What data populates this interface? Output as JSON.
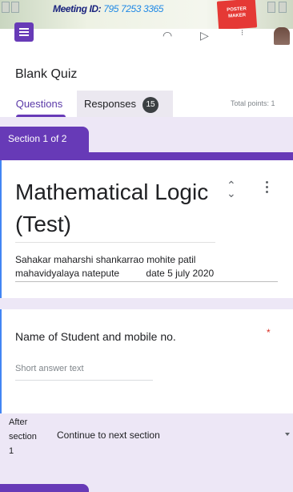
{
  "banner": {
    "meeting_label": "Meeting ID:",
    "meeting_id": "795 7253 3365",
    "poster_text": "POSTER MAKER"
  },
  "app": {
    "icons": [
      "forms-icon",
      "palette-icon",
      "send-icon",
      "more-vert-icon",
      "avatar"
    ]
  },
  "header": {
    "title": "Blank Quiz",
    "tabs": [
      {
        "label": "Questions",
        "active": true
      },
      {
        "label": "Responses",
        "badge": "15"
      }
    ],
    "total_points": "Total points: 1"
  },
  "section": {
    "label": "Section 1 of 2",
    "title": "Mathematical Logic  (Test)",
    "description": "Sahakar maharshi shankarrao mohite patil\nmahavidyalaya natepute          date 5 july 2020"
  },
  "question": {
    "title": "Name of Student and mobile no.",
    "required_mark": "*",
    "placeholder": "Short answer text"
  },
  "after_section": {
    "label": "After\nsection\n1",
    "action": "Continue to next section"
  },
  "colors": {
    "accent": "#673ab7",
    "background": "#ede7f6",
    "badge": "#3c4043"
  }
}
